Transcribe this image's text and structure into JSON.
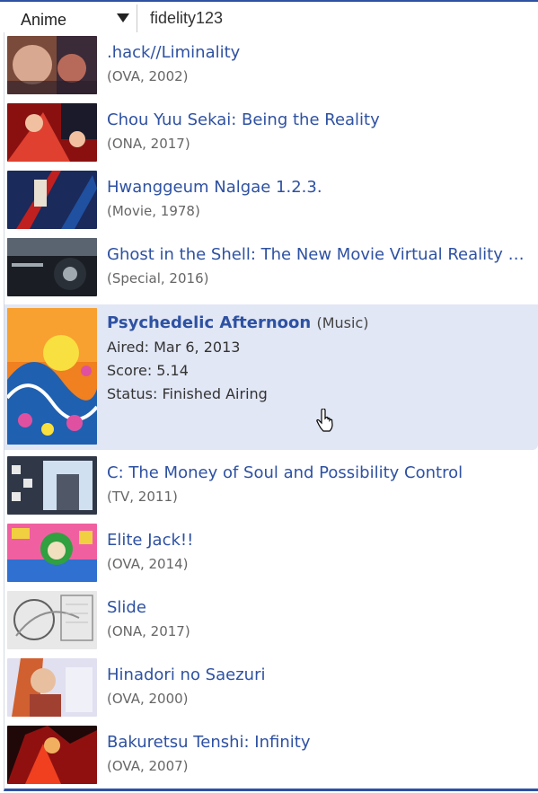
{
  "search": {
    "category": "Anime",
    "query": "fidelity123"
  },
  "results": [
    {
      "title": ".hack//Liminality",
      "meta": "(OVA, 2002)",
      "thumb_colors": [
        "#7a4a3a",
        "#d8a890",
        "#3b2a38",
        "#b86a5a"
      ]
    },
    {
      "title": "Chou Yuu Sekai: Being the Reality",
      "meta": "(ONA, 2017)",
      "thumb_colors": [
        "#8a1010",
        "#e04030",
        "#1a1a2a",
        "#f0c0a0"
      ]
    },
    {
      "title": "Hwanggeum Nalgae 1.2.3.",
      "meta": "(Movie, 1978)",
      "thumb_colors": [
        "#1a2a5a",
        "#c02020",
        "#e8e0d0",
        "#2050a0"
      ]
    },
    {
      "title": "Ghost in the Shell: The New Movie Virtual Reality Diver",
      "meta": "(Special, 2016)",
      "thumb_colors": [
        "#1a1e24",
        "#5a6470",
        "#a0a8b0",
        "#2a3038"
      ]
    }
  ],
  "featured": {
    "title": "Psychedelic Afternoon",
    "type": "(Music)",
    "aired": "Aired: Mar 6, 2013",
    "score": "Score: 5.14",
    "status": "Status: Finished Airing",
    "thumb_colors": [
      "#f08020",
      "#f8e040",
      "#2060b0",
      "#e050a0"
    ]
  },
  "results_after": [
    {
      "title": "C: The Money of Soul and Possibility Control",
      "meta": "(TV, 2011)",
      "thumb_colors": [
        "#303848",
        "#d0e0f0",
        "#e8e8e8",
        "#505868"
      ]
    },
    {
      "title": "Elite Jack!!",
      "meta": "(OVA, 2014)",
      "thumb_colors": [
        "#30a040",
        "#f060a0",
        "#f0d040",
        "#3070d0"
      ]
    },
    {
      "title": "Slide",
      "meta": "(ONA, 2017)",
      "thumb_colors": [
        "#e8e8e8",
        "#909090",
        "#c0c0c0",
        "#606060"
      ]
    },
    {
      "title": "Hinadori no Saezuri",
      "meta": "(OVA, 2000)",
      "thumb_colors": [
        "#e8c0a0",
        "#d06030",
        "#e0e0f0",
        "#a04030"
      ]
    },
    {
      "title": "Bakuretsu Tenshi: Infinity",
      "meta": "(OVA, 2007)",
      "thumb_colors": [
        "#901010",
        "#f04020",
        "#f0b060",
        "#200808"
      ]
    }
  ],
  "colors": {
    "accent": "#2e51a2",
    "hover_bg": "#e1e7f5",
    "meta_text": "#666666"
  }
}
